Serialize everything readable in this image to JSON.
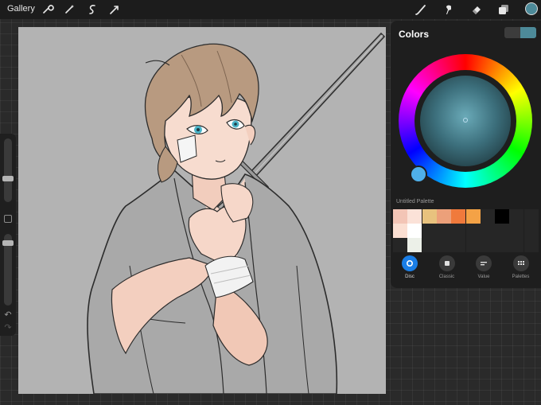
{
  "toolbar": {
    "gallery_label": "Gallery",
    "left_tools": [
      "wrench-icon",
      "magic-wand-icon",
      "selection-icon",
      "transform-icon"
    ],
    "right_tools": [
      "brush-icon",
      "smudge-icon",
      "eraser-icon",
      "layers-icon"
    ],
    "current_color": "#4d8a99"
  },
  "colors_panel": {
    "title": "Colors",
    "primary_color": "#3c3c3c",
    "secondary_color": "#4d8a99",
    "hue_marker_color": "#4fb0ea",
    "palette_name": "Untitled Palette",
    "palette_swatches": [
      [
        "#f3c5b6",
        "#fbe2d8",
        "#e8c27e",
        "#eca07a",
        "#f07a3c",
        "#f4a246",
        "#262626",
        "#000000",
        "#262626",
        "#262626"
      ],
      [
        "#fbdfd2",
        "#ffffff",
        "#262626",
        "#262626",
        "#262626",
        "#262626",
        "#262626",
        "#262626",
        "#262626",
        "#262626"
      ],
      [
        "#262626",
        "#ecf0e8",
        "#262626",
        "#262626",
        "#262626",
        "#262626",
        "#262626",
        "#262626",
        "#262626",
        "#262626"
      ]
    ],
    "tabs": [
      {
        "label": "Disc",
        "icon": "disc-icon",
        "active": true
      },
      {
        "label": "Classic",
        "icon": "classic-square-icon",
        "active": false
      },
      {
        "label": "Value",
        "icon": "value-sliders-icon",
        "active": false
      },
      {
        "label": "Palettes",
        "icon": "palettes-grid-icon",
        "active": false
      }
    ]
  },
  "sidebar": {
    "brush_size_level": 0.35,
    "opacity_level": 0.1
  },
  "canvas": {
    "background_color": "#b3b3b3"
  }
}
